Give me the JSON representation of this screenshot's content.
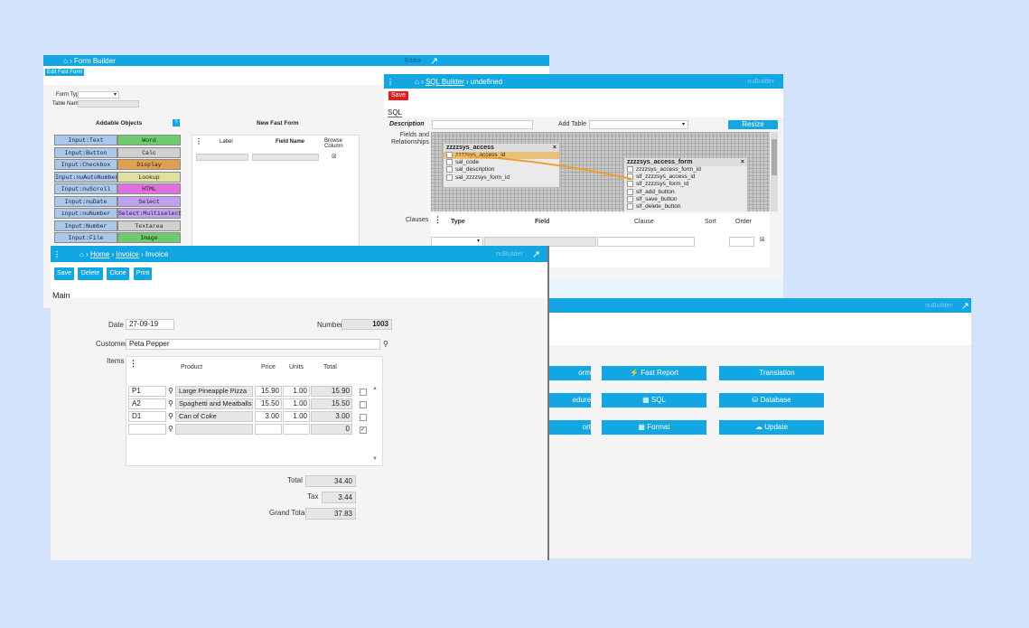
{
  "form_builder": {
    "title": "Form Builder",
    "right": "Editor",
    "edit_tab": "Edit Fast Form",
    "form_type_label": "Form Type",
    "table_name_label": "Table Name",
    "addable_title": "Addable Objects",
    "new_form_title": "New Fast Form",
    "help": "?",
    "col_label": "Label",
    "col_field": "Field Name",
    "col_browse": "Browse Column",
    "objects": [
      {
        "left": "Input:Text",
        "right": "Word"
      },
      {
        "left": "Input:Button",
        "right": "Calc"
      },
      {
        "left": "Input:Checkbox",
        "right": "Display"
      },
      {
        "left": "Input:nuAutoNumber",
        "right": "Lookup"
      },
      {
        "left": "Input:nuScroll",
        "right": "HTML"
      },
      {
        "left": "Input:nuDate",
        "right": "Select"
      },
      {
        "left": "input:nuNumber",
        "right": "Select:Multiselect"
      },
      {
        "left": "Input:Number",
        "right": "Textarea"
      },
      {
        "left": "Input:File",
        "right": "Image"
      }
    ]
  },
  "sql_builder": {
    "breadcrumb_link": "SQL Builder",
    "breadcrumb_rest": "undefined",
    "right": "nuBuilder",
    "save": "Save",
    "sql_tab": "SQL",
    "description_label": "Description",
    "add_table_label": "Add Table",
    "resize": "Resize",
    "fields_label": "Fields and Relationships",
    "clauses_label": "Clauses",
    "col_type": "Type",
    "col_field": "Field",
    "col_clause": "Clause",
    "col_sort": "Sort",
    "col_order": "Order",
    "table1": {
      "name": "zzzzsys_access",
      "rows": [
        "zzzzsys_access_id",
        "sal_code",
        "sal_description",
        "sal_zzzzsys_form_id"
      ]
    },
    "table2": {
      "name": "zzzzsys_access_form",
      "rows": [
        "zzzzsys_access_form_id",
        "slf_zzzzsys_access_id",
        "slf_zzzzsys_form_id",
        "slf_add_button",
        "slf_save_button",
        "slf_delete_button"
      ]
    }
  },
  "home": {
    "right": "nuBuilder",
    "buttons": [
      {
        "label": "Fast Report",
        "icon": "bolt-icon"
      },
      {
        "label": "Translation",
        "icon": "globe-icon"
      },
      {
        "label": "SQL",
        "icon": "table-icon"
      },
      {
        "label": "Database",
        "icon": "database-icon"
      },
      {
        "label": "Format",
        "icon": "calendar-icon"
      },
      {
        "label": "Update",
        "icon": "cloud-download-icon"
      }
    ],
    "partial": [
      "orm",
      "edure",
      "ort"
    ]
  },
  "invoice": {
    "breadcrumb_home": "Home",
    "breadcrumb_invoice": "Invoice",
    "breadcrumb_current": "Invoice",
    "right": "nuBuilder",
    "buttons": {
      "save": "Save",
      "delete": "Delete",
      "clone": "Clone",
      "print": "Print"
    },
    "tab": "Main",
    "date_label": "Date",
    "date_value": "27-09-19",
    "number_label": "Number",
    "number_value": "1003",
    "customer_label": "Customer",
    "customer_value": "Peta Pepper",
    "items_label": "Items",
    "col_product": "Product",
    "col_price": "Price",
    "col_units": "Units",
    "col_total": "Total",
    "items": [
      {
        "code": "P1",
        "product": "Large Pineapple Pizza",
        "price": "15.90",
        "units": "1.00",
        "total": "15.90"
      },
      {
        "code": "A2",
        "product": "Spaghetti and Meatballs",
        "price": "15.50",
        "units": "1.00",
        "total": "15.50"
      },
      {
        "code": "D1",
        "product": "Can of Coke",
        "price": "3.00",
        "units": "1.00",
        "total": "3.00"
      },
      {
        "code": "",
        "product": "",
        "price": "",
        "units": "",
        "total": "0"
      }
    ],
    "total_label": "Total",
    "total_value": "34.40",
    "tax_label": "Tax",
    "tax_value": "3.44",
    "grand_label": "Grand Total",
    "grand_value": "37.83"
  }
}
